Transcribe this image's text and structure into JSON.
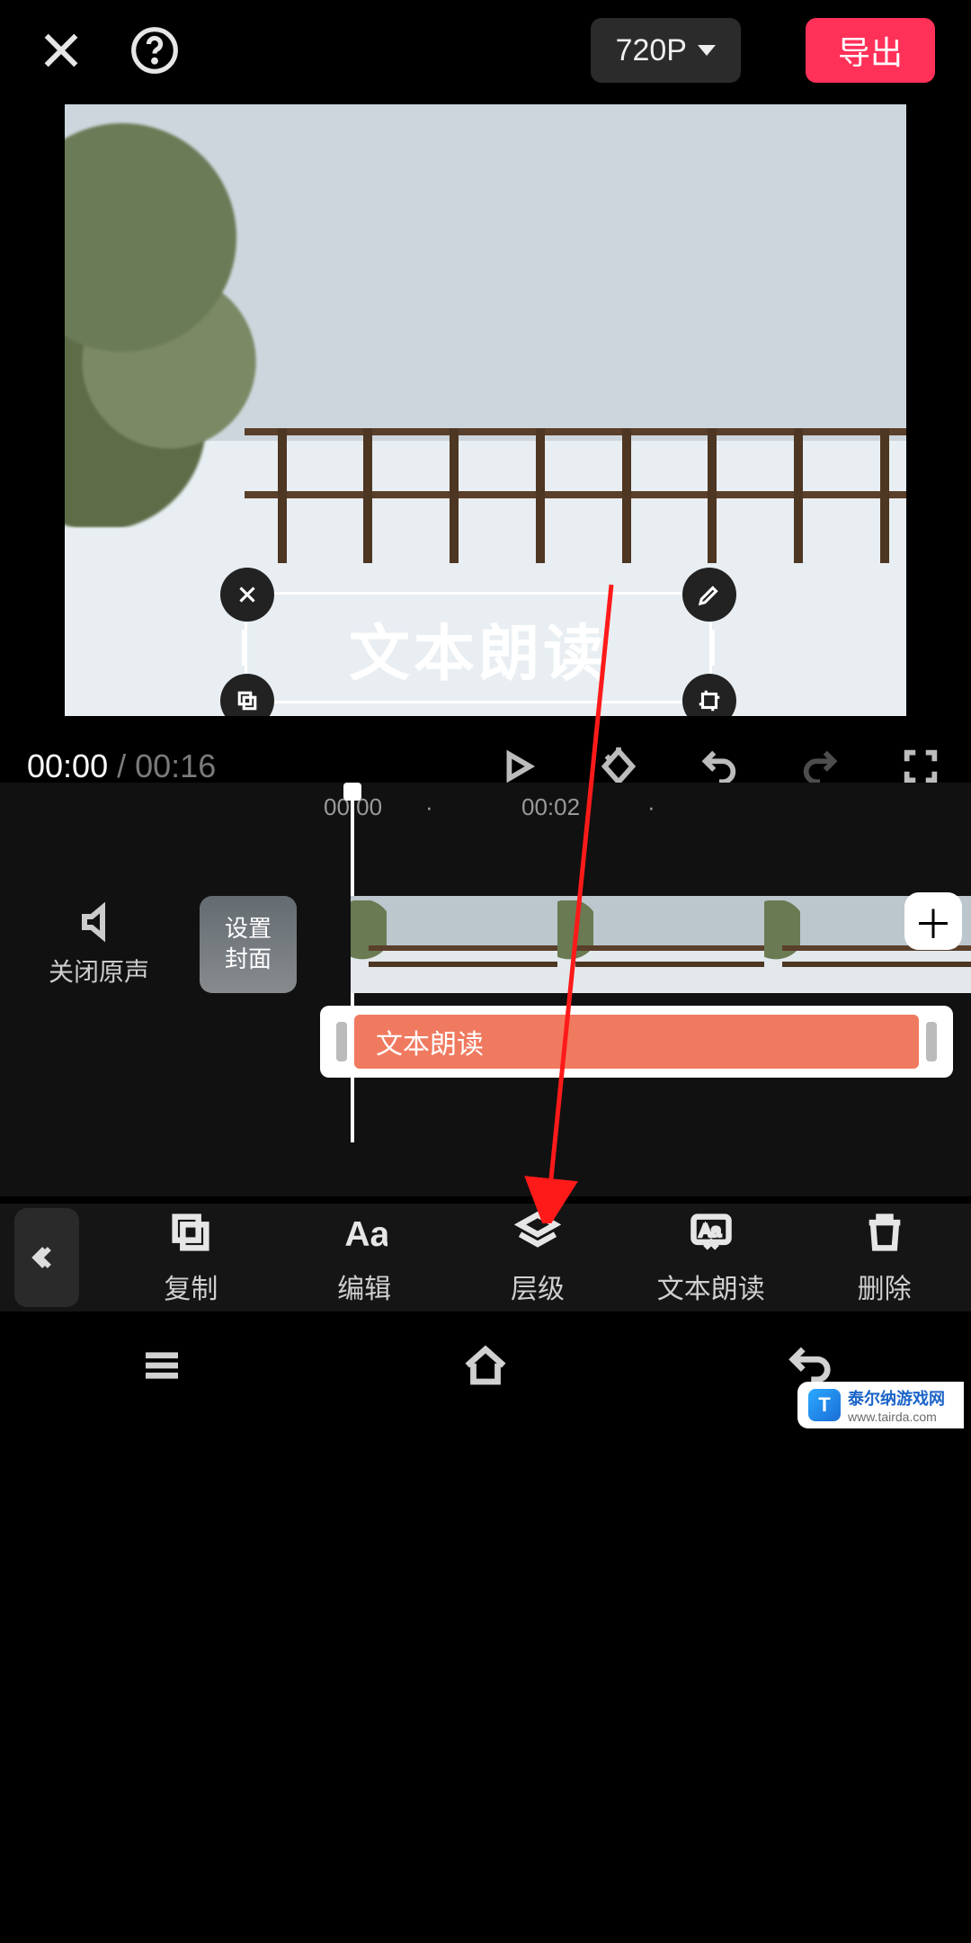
{
  "topbar": {
    "resolution_label": "720P",
    "export_label": "导出"
  },
  "overlay": {
    "text": "文本朗读"
  },
  "playback": {
    "current": "00:00",
    "duration": "00:16"
  },
  "ruler": {
    "marks": [
      "00:00",
      "00:02"
    ]
  },
  "left_controls": {
    "mute_label": "关闭原声",
    "cover_label": "设置\n封面"
  },
  "text_track": {
    "label": "文本朗读"
  },
  "toolbar": {
    "items": [
      {
        "key": "copy",
        "label": "复制"
      },
      {
        "key": "edit",
        "label": "编辑"
      },
      {
        "key": "layer",
        "label": "层级"
      },
      {
        "key": "tts",
        "label": "文本朗读"
      },
      {
        "key": "delete",
        "label": "删除"
      }
    ]
  },
  "watermark": {
    "brand": "泰尔纳游戏网",
    "url": "www.tairda.com"
  }
}
